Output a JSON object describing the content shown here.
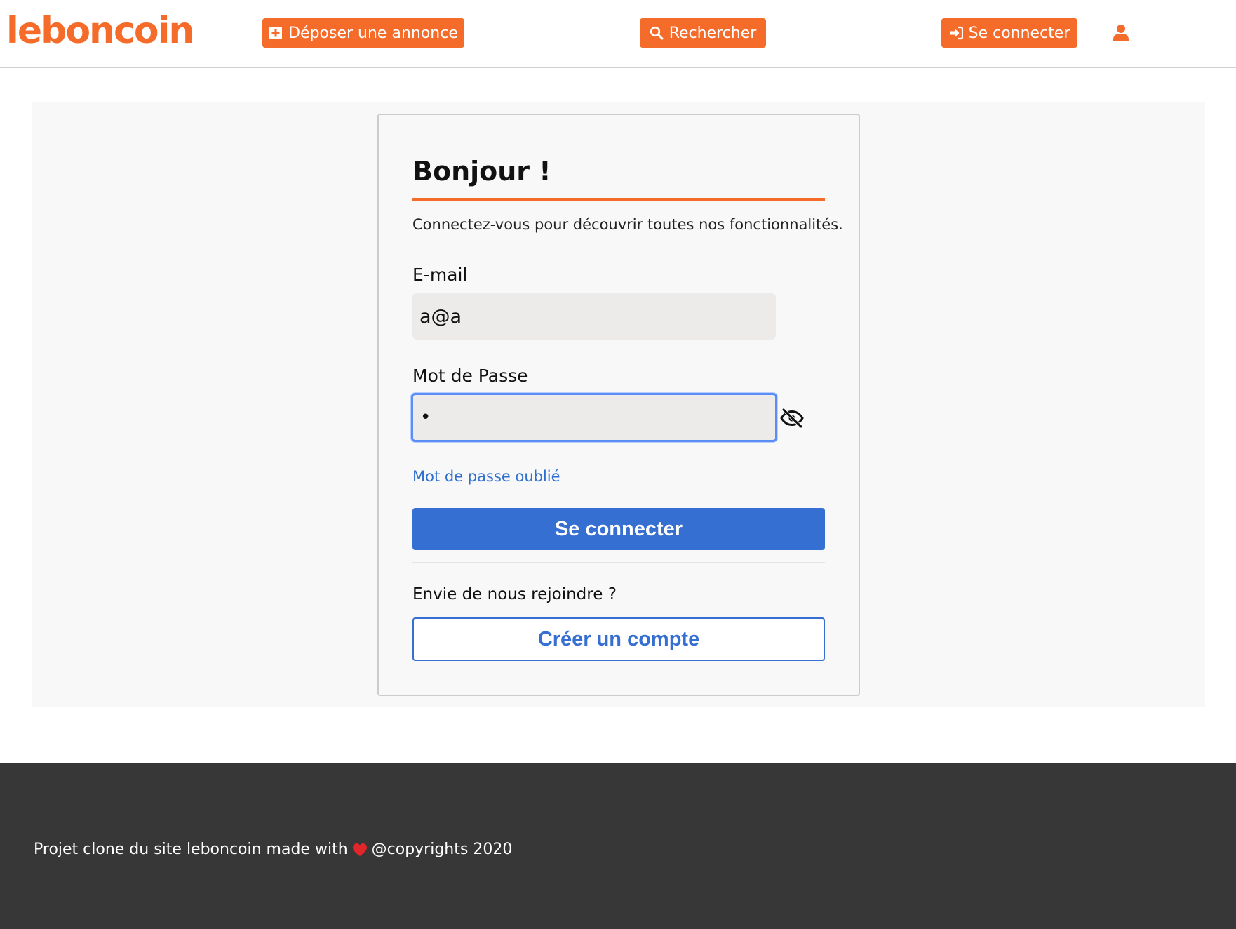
{
  "header": {
    "logo_text": "leboncoin",
    "deposer_label": "Déposer une annonce",
    "rechercher_label": "Rechercher",
    "connect_label": "Se connecter",
    "icons": {
      "deposer": "plus-square-icon",
      "rechercher": "search-icon",
      "connect": "sign-in-icon",
      "user": "user-icon"
    }
  },
  "login": {
    "title": "Bonjour !",
    "subtitle": "Connectez-vous pour découvrir toutes nos fonctionnalités.",
    "email_label": "E-mail",
    "email_value": "a@a",
    "password_label": "Mot de Passe",
    "password_value": "•",
    "toggle_icon": "eye-slash-icon",
    "forgot_link": "Mot de passe oublié",
    "submit_label": "Se connecter",
    "join_text": "Envie de nous rejoindre ?",
    "create_account_label": "Créer un compte"
  },
  "footer": {
    "text_before": "Projet clone du site leboncoin made with",
    "heart_icon": "heart-icon",
    "text_after": "@copyrights 2020"
  },
  "colors": {
    "brand_orange": "#f56b2a",
    "primary_blue": "#366fd2",
    "footer_bg": "#373737",
    "panel_bg": "#f8f8f8"
  }
}
